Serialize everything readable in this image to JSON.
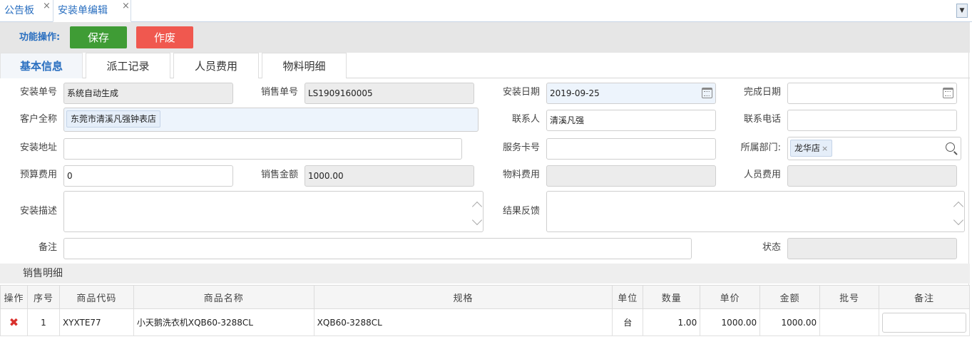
{
  "tabs": [
    {
      "label": "公告板",
      "close": "×"
    },
    {
      "label": "安装单编辑",
      "close": "×"
    }
  ],
  "toolbar": {
    "label": "功能操作:",
    "save": "保存",
    "void": "作废"
  },
  "inner_tabs": [
    "基本信息",
    "派工记录",
    "人员费用",
    "物料明细"
  ],
  "form": {
    "install_no": {
      "label": "安装单号",
      "value": "系统自动生成"
    },
    "sale_no": {
      "label": "销售单号",
      "value": "LS1909160005"
    },
    "install_date": {
      "label": "安装日期",
      "value": "2019-09-25"
    },
    "finish_date": {
      "label": "完成日期",
      "value": ""
    },
    "customer": {
      "label": "客户全称",
      "value": "东莞市清溪凡强钟表店"
    },
    "contact": {
      "label": "联系人",
      "value": "清溪凡强"
    },
    "phone": {
      "label": "联系电话",
      "value": ""
    },
    "address": {
      "label": "安装地址",
      "value": ""
    },
    "service_card": {
      "label": "服务卡号",
      "value": ""
    },
    "department": {
      "label": "所属部门:",
      "value": "龙华店",
      "remove": "×"
    },
    "budget": {
      "label": "预算费用",
      "value": "0"
    },
    "sale_amount": {
      "label": "销售金额",
      "value": "1000.00"
    },
    "material_fee": {
      "label": "物料费用",
      "value": ""
    },
    "staff_fee": {
      "label": "人员费用",
      "value": ""
    },
    "desc": {
      "label": "安装描述",
      "value": ""
    },
    "feedback": {
      "label": "结果反馈",
      "value": ""
    },
    "remark": {
      "label": "备注",
      "value": ""
    },
    "status": {
      "label": "状态",
      "value": ""
    }
  },
  "section_title": "销售明细",
  "table": {
    "headers": [
      "操作",
      "序号",
      "商品代码",
      "商品名称",
      "规格",
      "单位",
      "数量",
      "单价",
      "金额",
      "批号",
      "备注"
    ],
    "rows": [
      {
        "seq": "1",
        "code": "XYXTE77",
        "name": "小天鹅洗衣机XQB60-3288CL",
        "spec": "XQB60-3288CL",
        "unit": "台",
        "qty": "1.00",
        "price": "1000.00",
        "amount": "1000.00",
        "batch": "",
        "remark": ""
      }
    ]
  }
}
